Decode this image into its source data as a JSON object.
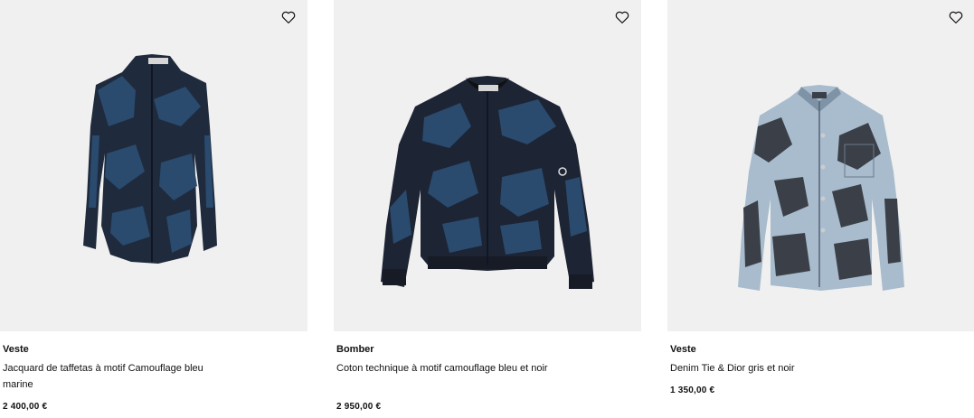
{
  "products": [
    {
      "category": "Veste",
      "description": "Jacquard de taffetas à motif Camouflage bleu marine",
      "price": "2 400,00 €",
      "image_alt": "Veste Jacquard de taffetas à motif Camouflage bleu marine",
      "favorite_icon": "heart-outline-icon"
    },
    {
      "category": "Bomber",
      "description": "Coton technique à motif camouflage bleu et noir",
      "price": "2 950,00 €",
      "image_alt": "Bomber coton technique à motif camouflage bleu et noir",
      "favorite_icon": "heart-outline-icon"
    },
    {
      "category": "Veste",
      "description": "Denim Tie & Dior gris et noir",
      "price": "1 350,00 €",
      "image_alt": "Veste Denim Tie & Dior gris et noir",
      "favorite_icon": "heart-outline-icon"
    }
  ],
  "colors": {
    "image_background": "#f0f0f0",
    "navy": "#1d2b44",
    "camo_blue": "#2a4a6e",
    "denim_light": "#a8bccd",
    "denim_dark": "#3b3f48"
  }
}
